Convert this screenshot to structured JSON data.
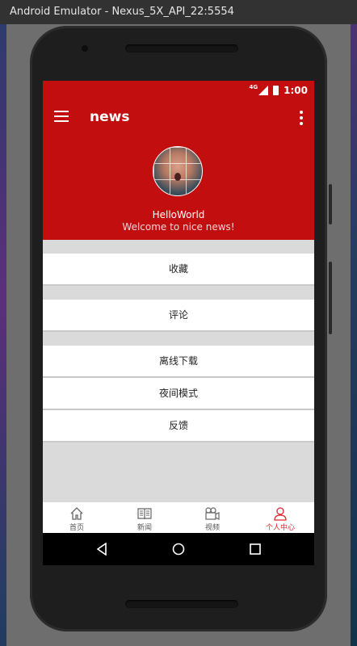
{
  "window": {
    "title": "Android Emulator - Nexus_5X_API_22:5554"
  },
  "status_bar": {
    "network": "4G",
    "time": "1:00"
  },
  "toolbar": {
    "title": "news"
  },
  "profile": {
    "username": "HelloWorld",
    "welcome": "Welcome to nice news!"
  },
  "menu": {
    "favorites": "收藏",
    "comments": "评论",
    "offline_download": "离线下载",
    "night_mode": "夜间模式",
    "feedback": "反馈"
  },
  "bottom_nav": {
    "home": "首页",
    "news": "新闻",
    "video": "视频",
    "profile": "个人中心",
    "active": "profile"
  },
  "colors": {
    "accent": "#c20e0e",
    "active_tab": "#e0262a"
  }
}
